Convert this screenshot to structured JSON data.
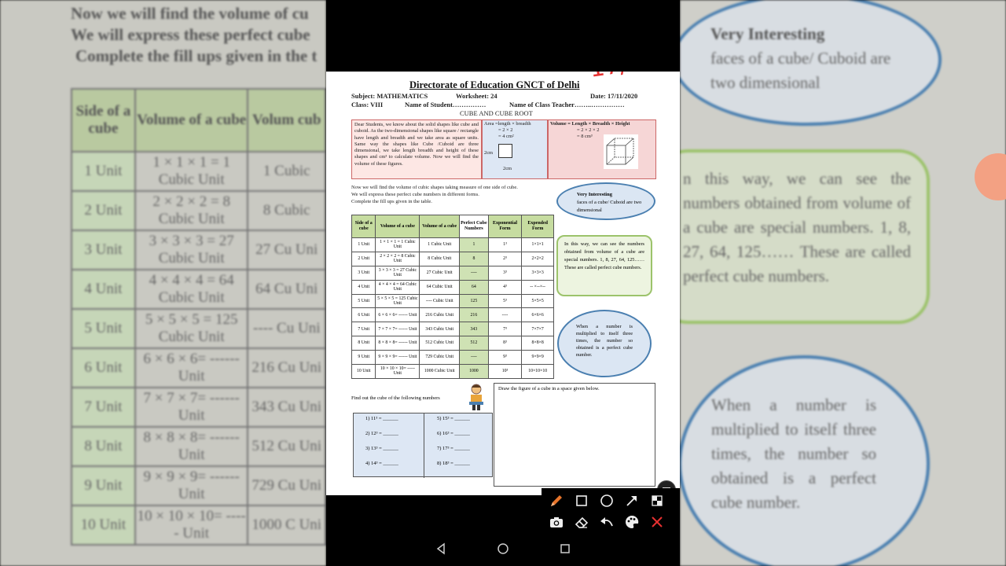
{
  "left_backdrop": {
    "lines": [
      "Now we will find the volume of cu",
      "We will express these perfect cube",
      "Complete the fill ups given in the t"
    ],
    "headers": [
      "Side of a cube",
      "Volume of a cube",
      "Volum cub"
    ],
    "rows": [
      [
        "1 Unit",
        "1 × 1 × 1 = 1 Cubic Unit",
        "1 Cubic"
      ],
      [
        "2 Unit",
        "2 × 2 × 2 = 8 Cubic Unit",
        "8 Cubic"
      ],
      [
        "3 Unit",
        "3 × 3 × 3 = 27 Cubic Unit",
        "27 Cu Uni"
      ],
      [
        "4 Unit",
        "4 × 4 × 4 = 64 Cubic Unit",
        "64 Cu Uni"
      ],
      [
        "5 Unit",
        "5 × 5 × 5 = 125 Cubic Unit",
        "---- Cu Uni"
      ],
      [
        "6 Unit",
        "6 × 6 × 6= ------ Unit",
        "216 Cu Uni"
      ],
      [
        "7 Unit",
        "7 × 7 × 7= ------ Unit",
        "343 Cu Uni"
      ],
      [
        "8 Unit",
        "8 × 8 × 8= ------ Unit",
        "512 Cu Uni"
      ],
      [
        "9 Unit",
        "9 × 9 × 9= ------ Unit",
        "729 Cu Uni"
      ],
      [
        "10 Unit",
        "10 × 10 × 10= ----- Unit",
        "1000 C Uni"
      ]
    ]
  },
  "right_backdrop": {
    "oval_top_title": "Very Interesting",
    "oval_top_text": "faces of a cube/ Cuboid are two dimensional",
    "green_text": "n this way, we can see the numbers obtained from volume of a cube are special numbers. 1, 8, 27, 64, 125…… These are called perfect cube numbers.",
    "oval_bottom_text": "When a number is multiplied to itself three times, the number so obtained is a perfect cube number."
  },
  "worksheet": {
    "header": "Directorate of Education GNCT of Delhi",
    "annotation": "17/10",
    "subject": "Subject: MATHEMATICS",
    "worksheet_no": "Worksheet: 24",
    "date": "Date: 17/11/2020",
    "class": "Class: VIII",
    "student": "Name of Student……………",
    "teacher": "Name of Class Teacher……..……………",
    "topic": "CUBE AND CUBE ROOT",
    "intro": "Dear Students, we know about the solid shapes like cube and cuboid. As the two-dimensional shapes like square / rectangle have length and breadth and we take area as square units. Same way the shapes like Cube /Cuboid are three dimensional, we take length breadth and height of these shapes and cm³ to calculate volume. Now we will find the volume of these figures.",
    "area_lines": [
      "Area =length × breadth",
      "= 2 × 2",
      "= 4 cm²"
    ],
    "area_side": "2cm",
    "area_bottom": "2cm",
    "volume_lines": [
      "Volume = Length × Breadth × Height",
      "= 2 × 2 × 2",
      "= 8 cm³"
    ],
    "para": [
      "Now we will find the volume of cubic shapes taking measure of one side of cube.",
      "We will express these perfect cube numbers  in different forms.",
      "Complete the fill ups given in the table."
    ],
    "table_headers": [
      "Side of a cube",
      "Volume of a cube",
      "Volume of a cube",
      "Perfect Cube Numbers",
      "Exponential Form",
      "Expended Form"
    ],
    "table_rows": [
      [
        "1 Unit",
        "1 × 1 × 1 = 1 Cubic Unit",
        "1 Cubic Unit",
        "1",
        "1³",
        "1×1×1"
      ],
      [
        "2 Unit",
        "2 × 2 × 2 = 8 Cubic Unit",
        "8 Cubic Unit",
        "8",
        "2³",
        "2×2×2"
      ],
      [
        "3 Unit",
        "3 × 3 × 3 = 27 Cubic Unit",
        "27 Cubic Unit",
        "----",
        "3³",
        "3×3×3"
      ],
      [
        "4 Unit",
        "4 × 4 × 4 = 64 Cubic Unit",
        "64 Cubic Unit",
        "64",
        "4³",
        "-- ×--×--"
      ],
      [
        "5 Unit",
        "5 × 5 × 5 = 125 Cubic Unit",
        "---- Cubic Unit",
        "125",
        "5³",
        "5×5×5"
      ],
      [
        "6 Unit",
        "6 × 6 × 6= ------ Unit",
        "216 Cubic Unit",
        "216",
        "----",
        "6×6×6"
      ],
      [
        "7 Unit",
        "7 × 7 × 7= ------ Unit",
        "343 Cubic Unit",
        "343",
        "7³",
        "7×7×7"
      ],
      [
        "8 Unit",
        "8 × 8 × 8= ------ Unit",
        "512 Cubic Unit",
        "512",
        "8³",
        "8×8×8"
      ],
      [
        "9 Unit",
        "9 × 9 × 9= ------ Unit",
        "729 Cubic Unit",
        "----",
        "9³",
        "9×9×9"
      ],
      [
        "10 Unit",
        "10 × 10 × 10= ----- Unit",
        "1000 Cubic Unit",
        "1000",
        "10³",
        "10×10×10"
      ]
    ],
    "oval1_title": "Very Interesting",
    "oval1_text": "faces of a cube/ Cuboid are two dimensional",
    "green_text": "In this way, we can see the numbers obtained from volume of a cube are special numbers. 1, 8, 27, 64, 125…… These are called perfect cube numbers.",
    "oval2_text": "When a number is multiplied to itself three times, the number so obtained is a perfect cube number.",
    "find_text": "Find out the cube of the following numbers",
    "cube_questions": [
      "1)  11³  =  ______",
      "2)  12³  =  ______",
      "3)  13³  =  ______",
      "4)  14³  =  ______",
      "5)  15³  =  ______",
      "6)  16³  =  ______",
      "7)  17³  =  ______",
      "8)  18³  =  ______"
    ],
    "draw_text": "Draw the figure of a cube in a space given below."
  },
  "toolbar": {
    "icons": [
      "pen-icon",
      "rectangle-icon",
      "circle-icon",
      "arrow-icon",
      "mosaic-icon",
      "camera-icon",
      "eraser-icon",
      "undo-icon",
      "palette-icon",
      "close-icon"
    ],
    "accent": "#e8752b",
    "close_color": "#e53030"
  }
}
